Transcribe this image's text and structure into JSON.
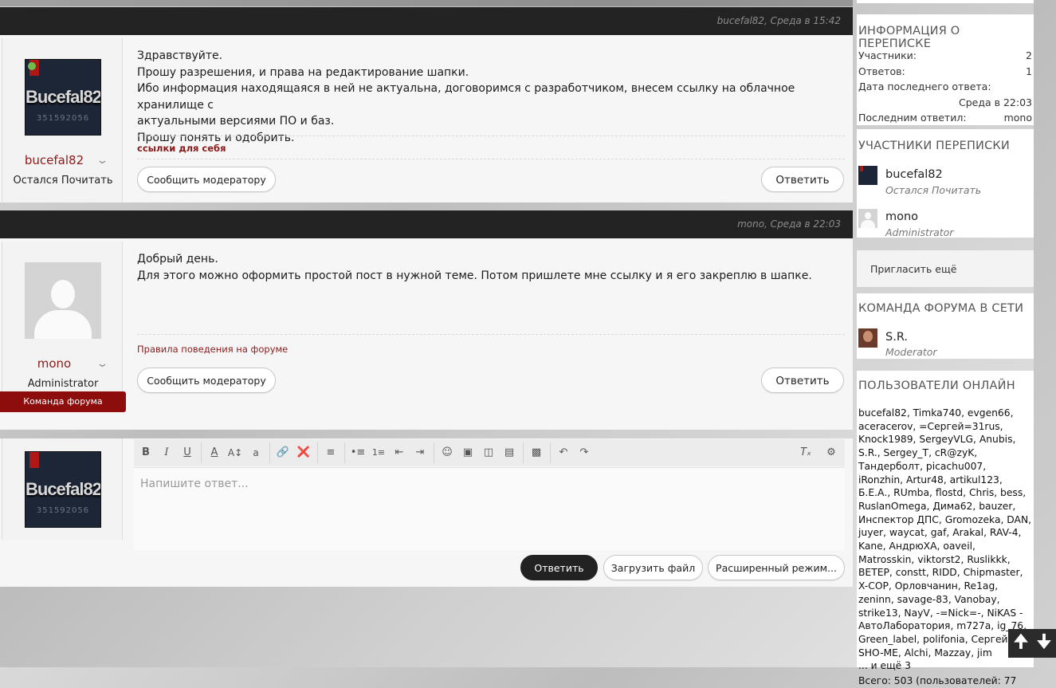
{
  "posts": [
    {
      "header": "bucefal82, Среда в 15:42",
      "author": "bucefal82",
      "user_title": "Остался Почитать",
      "avatar_logo": "Bucefal82",
      "avatar_number": "351592056",
      "lines": [
        "Здравствуйте.",
        "Прошу разрешения, и права на редактирование шапки.",
        "Ибо информация находящаяся в ней не актуальна, договоримся с разработчиком, внесем ссылку на облачное хранилище с",
        "актуальными версиями ПО и баз.",
        "Прошу понять и одобрить."
      ],
      "signature": "ссылки для себя",
      "report_label": "Сообщить модератору",
      "reply_label": "Ответить"
    },
    {
      "header": "mono, Среда в 22:03",
      "author": "mono",
      "user_title": "Administrator",
      "team_badge": "Команда форума",
      "lines": [
        "Добрый день.",
        "Для этого можно оформить простой пост в нужной теме. Потом пришлете мне ссылку и я его закреплю в шапке."
      ],
      "signature": "Правила поведения на форуме",
      "report_label": "Сообщить модератору",
      "reply_label": "Ответить"
    }
  ],
  "editor": {
    "avatar_logo": "Bucefal82",
    "avatar_number": "351592056",
    "placeholder": "Напишите ответ...",
    "toolbar_icons": [
      "bold-icon",
      "italic-icon",
      "underline-icon",
      "font-color-icon",
      "font-size-icon",
      "font-family-icon",
      "link-icon",
      "unlink-icon",
      "align-icon",
      "bullet-list-icon",
      "numbered-list-icon",
      "outdent-icon",
      "indent-icon",
      "smilie-icon",
      "image-icon",
      "media-icon",
      "insert-icon",
      "save-draft-icon",
      "undo-icon",
      "redo-icon",
      "remove-format-icon",
      "toggle-bbcode-icon"
    ],
    "reply_label": "Ответить",
    "upload_label": "Загрузить файл",
    "advanced_label": "Расширенный режим..."
  },
  "sidebar": {
    "conversation_info": {
      "title": "ИНФОРМАЦИЯ О ПЕРЕПИСКЕ",
      "participants_label": "Участники:",
      "participants_value": "2",
      "replies_label": "Ответов:",
      "replies_value": "1",
      "last_reply_date_label": "Дата последнего ответа:",
      "last_reply_date_value": "Среда в 22:03",
      "last_replier_label": "Последним ответил:",
      "last_replier_value": "mono"
    },
    "participants": {
      "title": "УЧАСТНИКИ ПЕРЕПИСКИ",
      "items": [
        {
          "name": "bucefal82",
          "role": "Остался Почитать"
        },
        {
          "name": "mono",
          "role": "Administrator"
        }
      ]
    },
    "invite_label": "Пригласить ещё",
    "staff_online": {
      "title": "КОМАНДА ФОРУМА В СЕТИ",
      "name": "S.R.",
      "role": "Moderator"
    },
    "users_online": {
      "title": "ПОЛЬЗОВАТЕЛИ ОНЛАЙН",
      "list": "bucefal82, Timka740, evgen66, aceracerov, =Сергей=31rus, Knock1989, SergeyVLG, Anubis, S.R., Sergey_T, cR@zyK, Тандерболт, picachu007, iRonzhin, Artur48, artikul123, Б.Е.А., RUmba, flostd, Chris, bess, RuslanOmega, Дима62, bauzer, Инспектор ДПС, Gromozeka, DAN, juyer, waycat, gaf, Arakal, RAV-4, Kane, АндрюХА, oaveil, Matrosskin, viktorst2, Ruslikkk, ВЕТЕР, constt, RIDD, Chipmaster, X-COP, Орловчанин, Re1ag, zeninn, savage-83, Vanobay, strike13, NayV, -=Nick=-, NiKAS - АвтоЛаборатория, m727a, ig_76, Green_label, polifonia, Сергей SHO-ME, Alchi, Mazzay, jim",
      "more": "... и ещё 3",
      "total": "Всего: 503 (пользователей: 77"
    }
  },
  "scroll": {
    "up_icon": "arrow-up-icon",
    "down_icon": "arrow-down-icon"
  }
}
